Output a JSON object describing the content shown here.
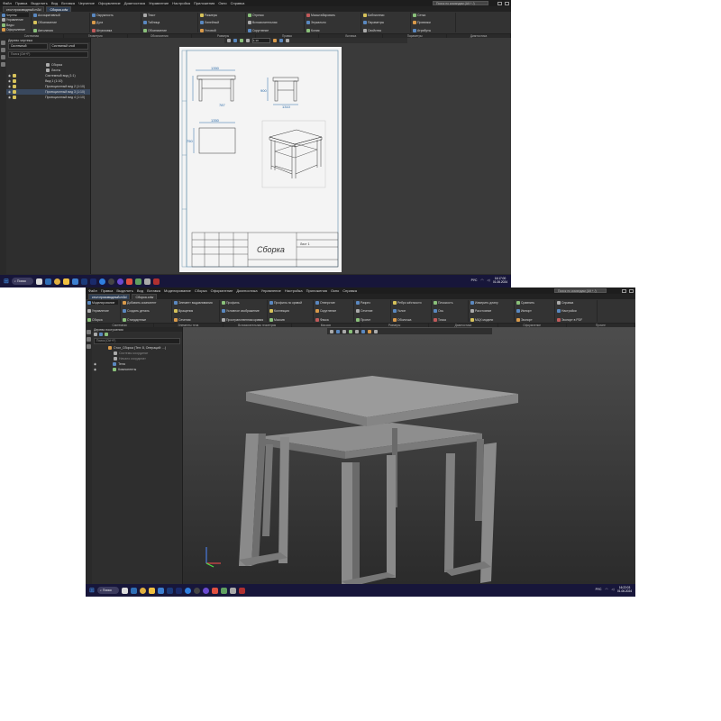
{
  "drawing_window": {
    "menu": [
      "Файл",
      "Правка",
      "Выделить",
      "Вид",
      "Вставка",
      "Черчение",
      "Оформление",
      "Диагностика",
      "Управление",
      "Настройка",
      "Приложения",
      "Окно",
      "Справка"
    ],
    "search_placeholder": "Поиск по командам (Alt + /)",
    "tabs": [
      {
        "label": "Сборка.cdw",
        "active": true
      }
    ],
    "doc_tab_left": "стол производный.m3d",
    "ribbon_left": [
      {
        "label": "Чертеж"
      },
      {
        "label": "Управление"
      },
      {
        "label": "Виды"
      },
      {
        "label": "Оформление"
      }
    ],
    "ribbon_groups": [
      [
        "Ассоциативный",
        "Обозначение",
        "Автолиния"
      ],
      [
        "Окружность",
        "Дуга",
        "Штриховка"
      ],
      [
        "Текст",
        "Таблица",
        "Обозначение"
      ],
      [
        "Размеры",
        "Линейный",
        "Угловой"
      ],
      [
        "Отрезок",
        "Вспомогательная",
        "Скругление"
      ],
      [
        "Масштабировать",
        "Зеркально",
        "Копия"
      ],
      [
        "Библиотеки",
        "Параметры",
        "Свойства"
      ],
      [
        "Сетка",
        "Привязки",
        "Атрибуты"
      ]
    ],
    "ribbon_labels": [
      "Системная",
      "Геометрия",
      "Обозначения",
      "Размеры",
      "Правка",
      "Вставка",
      "Параметры",
      "Диагностика"
    ],
    "tree_title": "Дерево чертежа",
    "tree_dropdown_1": "Системный",
    "tree_dropdown_2": "Системный слой",
    "tree_filter": "Поиск (Ctrl+F)",
    "tree_items": [
      "Сборка",
      "Листы",
      "Системный вид (1:1)",
      "Вид 1 (1:10)",
      "Проекционный вид 2 (1:10)",
      "Проекционный вид 3 (1:10)",
      "Проекционный вид 4 (1:10)"
    ],
    "drawing": {
      "title_text": "Сборка",
      "dim_1": "1350",
      "dim_2": "787",
      "dim_3": "1350",
      "dim_4": "1310",
      "dim_5": "900",
      "dim_6": "750",
      "dim_7": "900",
      "scale_label": "1:10",
      "title_sub": "Лист 1"
    },
    "taskbar_search": "Поиск",
    "tray_lang": "РУС",
    "clock_time": "16:17:00",
    "clock_date": "01.06.2024"
  },
  "model_window": {
    "menu": [
      "Файл",
      "Правка",
      "Выделить",
      "Вид",
      "Вставка",
      "Моделирование",
      "Сборка",
      "Оформление",
      "Диагностика",
      "Управление",
      "Настройка",
      "Приложения",
      "Окно",
      "Справка"
    ],
    "search_placeholder": "Поиск по командам (Alt + /)",
    "tabs": [
      {
        "label": "стол производный.m3d",
        "active": true
      },
      {
        "label": "Сборка.cdw",
        "active": false
      }
    ],
    "ribbon_left": [
      {
        "label": "Моделирование"
      },
      {
        "label": "Управление"
      },
      {
        "label": "Сборка"
      }
    ],
    "ribbon_groups": [
      [
        "Добавить компонент",
        "Создать деталь",
        "Стандартные"
      ],
      [
        "Элемент выдавливания",
        "Вращения",
        "Сечения"
      ],
      [
        "Профиль",
        "Условное изображение",
        "Пространственная кривая"
      ],
      [
        "Профиль по кривой",
        "Коллекция",
        "Массив"
      ],
      [
        "Отверстие",
        "Скругление",
        "Фаска"
      ],
      [
        "Разрез",
        "Сечение",
        "Проект"
      ],
      [
        "Ребро жёсткости",
        "Уклон",
        "Оболочка"
      ],
      [
        "Плоскость",
        "Ось",
        "Точка"
      ],
      [
        "Измерить длину",
        "Расстояние",
        "МЦХ модели"
      ],
      [
        "Сравнить",
        "Импорт",
        "Экспорт"
      ],
      [
        "Справка",
        "Настройки",
        "Экспорт в PDF"
      ]
    ],
    "ribbon_labels": [
      "Системная",
      "Элементы тела",
      "Вспомогательная геометрия",
      "Массив",
      "Размеры",
      "Диагностика",
      "Оформление",
      "Прочее"
    ],
    "tree_title": "Дерево построения",
    "tree_filter": "Поиск (Ctrl+F)",
    "tree_items": [
      "Стол_Сборка (Тел: 8, Операций: ...)",
      "Системы координат",
      "Начало координат",
      "Тела",
      "Компоненты"
    ],
    "taskbar_search": "Поиск",
    "tray_lang": "РУС",
    "clock_time": "16:22:03",
    "clock_date": "01.06.2024"
  },
  "colors": {
    "accent": "#2f6fb6",
    "taskbar": "#17163a",
    "viewport_top": "#4b4b4b",
    "viewport_bottom": "#2a2a2a",
    "table_top": "#9a9a9a",
    "table_side": "#7c7c7c"
  }
}
